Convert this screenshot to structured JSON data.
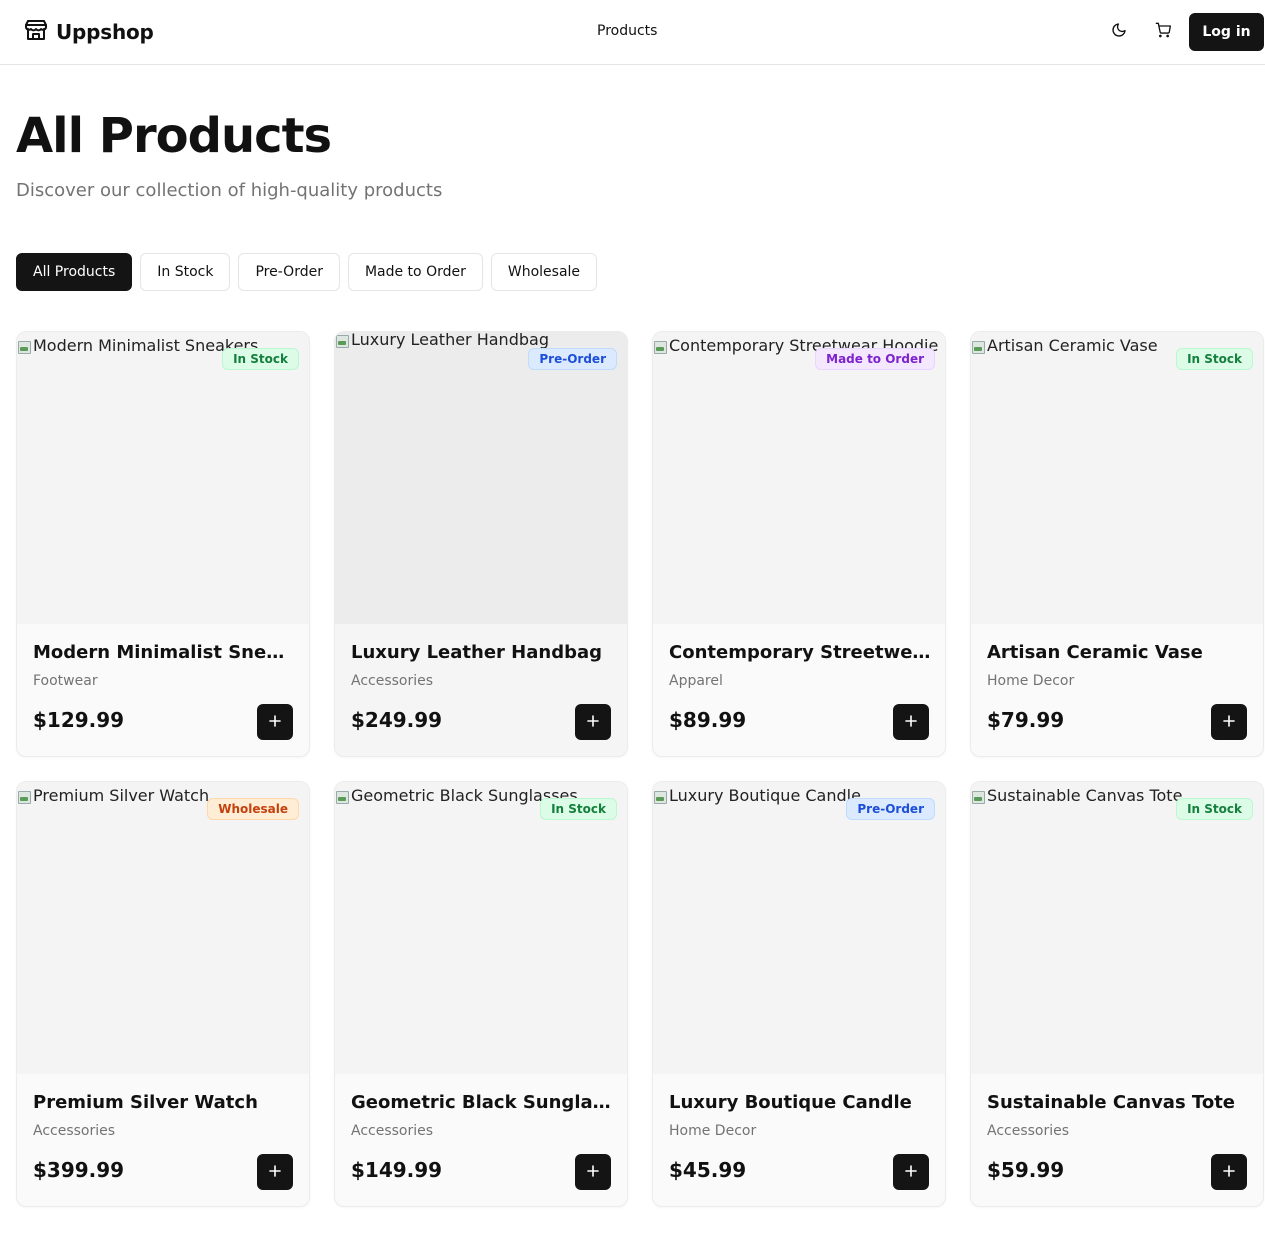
{
  "header": {
    "brand": "Uppshop",
    "nav_products": "Products",
    "login": "Log in"
  },
  "page": {
    "title": "All Products",
    "subtitle": "Discover our collection of high-quality products"
  },
  "filters": [
    {
      "label": "All Products",
      "active": true
    },
    {
      "label": "In Stock",
      "active": false
    },
    {
      "label": "Pre-Order",
      "active": false
    },
    {
      "label": "Made to Order",
      "active": false
    },
    {
      "label": "Wholesale",
      "active": false
    }
  ],
  "badge_colors": {
    "In Stock": {
      "bg": "#dcfce7",
      "fg": "#15803d",
      "border": "#bbf7d0"
    },
    "Pre-Order": {
      "bg": "#dbeafe",
      "fg": "#1d4ed8",
      "border": "#bfdbfe"
    },
    "Made to Order": {
      "bg": "#f3e8ff",
      "fg": "#7e22ce",
      "border": "#e9d5ff"
    },
    "Wholesale": {
      "bg": "#ffedd5",
      "fg": "#c2410c",
      "border": "#fed7aa"
    }
  },
  "products": [
    {
      "name": "Modern Minimalist Sneakers",
      "category": "Footwear",
      "price": "$129.99",
      "badge": "In Stock",
      "image_alt": "Modern Minimalist Sneakers"
    },
    {
      "name": "Luxury Leather Handbag",
      "category": "Accessories",
      "price": "$249.99",
      "badge": "Pre-Order",
      "image_alt": "Luxury Leather Handbag"
    },
    {
      "name": "Contemporary Streetwear Hoodie",
      "category": "Apparel",
      "price": "$89.99",
      "badge": "Made to Order",
      "image_alt": "Contemporary Streetwear Hoodie"
    },
    {
      "name": "Artisan Ceramic Vase",
      "category": "Home Decor",
      "price": "$79.99",
      "badge": "In Stock",
      "image_alt": "Artisan Ceramic Vase"
    },
    {
      "name": "Premium Silver Watch",
      "category": "Accessories",
      "price": "$399.99",
      "badge": "Wholesale",
      "image_alt": "Premium Silver Watch"
    },
    {
      "name": "Geometric Black Sunglasses",
      "category": "Accessories",
      "price": "$149.99",
      "badge": "In Stock",
      "image_alt": "Geometric Black Sunglasses"
    },
    {
      "name": "Luxury Boutique Candle",
      "category": "Home Decor",
      "price": "$45.99",
      "badge": "Pre-Order",
      "image_alt": "Luxury Boutique Candle"
    },
    {
      "name": "Sustainable Canvas Tote",
      "category": "Accessories",
      "price": "$59.99",
      "badge": "In Stock",
      "image_alt": "Sustainable Canvas Tote"
    }
  ]
}
